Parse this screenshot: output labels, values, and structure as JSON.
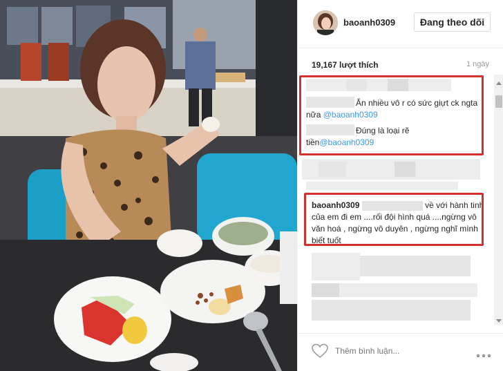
{
  "post": {
    "username": "baoanh0309",
    "follow_label": "Đang theo dõi",
    "likes": "19,167 lượt thích",
    "age": "1 ngày"
  },
  "comments": [
    {
      "text": "Ăn nhiều vô r có sức giựt ck ngta nữa",
      "mention": "@baoanh0309"
    },
    {
      "text": "Đúng là loại rẽ tiền",
      "mention": "@baoanh0309"
    },
    {
      "username": "baoanh0309",
      "text_line1": "về với hành tinh",
      "text_rest": "của em đi em ....rối đội hình quá ....ngừng vô văn hoá , ngừng vô duyên , ngừng nghĩ mình biết tuốt"
    }
  ],
  "composer": {
    "placeholder": "Thêm bình luận..."
  },
  "icons": {
    "like": "heart-outline-icon",
    "options": "more-options-icon"
  },
  "colors": {
    "highlight": "#d32f2f",
    "mention": "#3897f0",
    "text": "#262626"
  }
}
